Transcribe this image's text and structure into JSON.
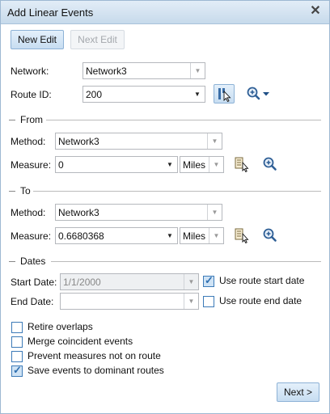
{
  "window": {
    "title": "Add Linear Events",
    "close_glyph": "✕"
  },
  "toolbar": {
    "new_edit": "New Edit",
    "next_edit": "Next Edit"
  },
  "network": {
    "label": "Network:",
    "value": "Network3"
  },
  "route": {
    "label": "Route ID:",
    "value": "200"
  },
  "from": {
    "section": "From",
    "method_label": "Method:",
    "method_value": "Network3",
    "measure_label": "Measure:",
    "measure_value": "0",
    "units": "Miles"
  },
  "to": {
    "section": "To",
    "method_label": "Method:",
    "method_value": "Network3",
    "measure_label": "Measure:",
    "measure_value": "0.6680368",
    "units": "Miles"
  },
  "dates": {
    "section": "Dates",
    "start_label": "Start Date:",
    "start_value": "1/1/2000",
    "use_start_label": "Use route start date",
    "use_start_checked": true,
    "end_label": "End Date:",
    "end_value": "",
    "use_end_label": "Use route end date",
    "use_end_checked": false
  },
  "options": [
    {
      "label": "Retire overlaps",
      "checked": false
    },
    {
      "label": "Merge coincident events",
      "checked": false
    },
    {
      "label": "Prevent measures not on route",
      "checked": false
    },
    {
      "label": "Save events to dominant routes",
      "checked": true
    }
  ],
  "footer": {
    "next": "Next >"
  },
  "icons": {
    "route_select": "select-route-on-map-icon",
    "route_zoom": "zoom-to-route-icon",
    "measure_pick": "pick-measure-on-map-icon",
    "measure_zoom": "zoom-to-measure-icon"
  },
  "colors": {
    "title_bar": "#c7daeb",
    "accent": "#3d7bb8",
    "checkbox_checked": "#cfe3f5"
  }
}
